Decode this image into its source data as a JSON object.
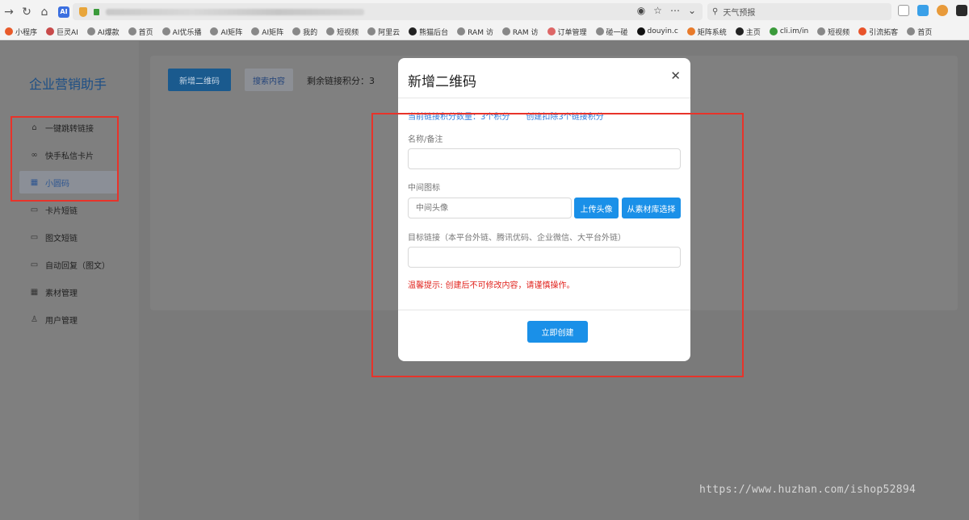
{
  "browser": {
    "search_placeholder": "天气预报",
    "bookmarks": [
      "小程序",
      "巨灵AI",
      "AI爆款",
      "首页",
      "AI优乐播",
      "AI矩阵",
      "AI矩阵",
      "我的",
      "短视频",
      "阿里云",
      "熊猫后台",
      "RAM 访",
      "RAM 访",
      "订单管理",
      "碰一碰",
      "douyin.c",
      "矩阵系统",
      "主页",
      "cli.im/in",
      "短视频",
      "引流拓客",
      "首页"
    ]
  },
  "sidebar": {
    "brand": "企业营销助手",
    "items": [
      {
        "label": "一键跳转链接",
        "icon": "home-icon"
      },
      {
        "label": "快手私信卡片",
        "icon": "link-icon"
      },
      {
        "label": "小圆码",
        "icon": "qrcode-icon"
      },
      {
        "label": "卡片短链",
        "icon": "card-icon"
      },
      {
        "label": "图文短链",
        "icon": "card-icon"
      },
      {
        "label": "自动回复（图文）",
        "icon": "card-icon"
      },
      {
        "label": "素材管理",
        "icon": "qrcode-icon"
      },
      {
        "label": "用户管理",
        "icon": "user-icon"
      }
    ]
  },
  "main": {
    "new_qrcode_button": "新增二维码",
    "search_button": "搜索内容",
    "remaining_points": "剩余链接积分：3"
  },
  "modal": {
    "title": "新增二维码",
    "hint_points": "当前链接积分数量：3个积分",
    "hint_cost": "创建扣除3个链接积分",
    "name_label": "名称/备注",
    "name_value": "",
    "icon_label": "中间图标",
    "icon_placeholder": "中间头像",
    "upload_button": "上传头像",
    "library_button": "从素材库选择",
    "target_label": "目标链接（本平台外链、腾讯优码、企业微信、大平台外链）",
    "target_value": "",
    "warning": "温馨提示: 创建后不可修改内容，请谨慎操作。",
    "create_button": "立即创建"
  },
  "watermark": "https://www.huzhan.com/ishop52894",
  "colors": {
    "primary": "#1a90e8",
    "annotation": "#e8332a",
    "warning": "#e0231d",
    "brand": "#1d4f86"
  }
}
